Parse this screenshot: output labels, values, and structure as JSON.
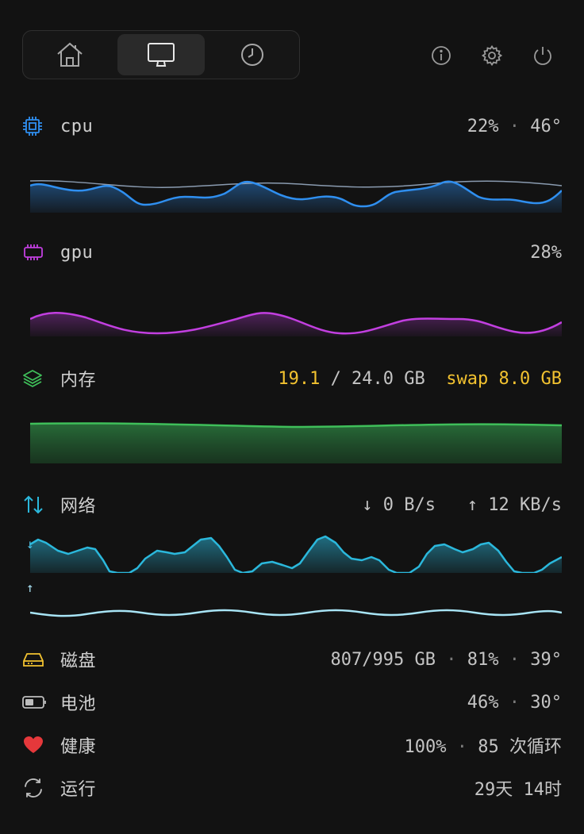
{
  "tabs": [
    {
      "name": "home",
      "icon": "home-icon",
      "active": false
    },
    {
      "name": "monitor",
      "icon": "monitor-icon",
      "active": true
    },
    {
      "name": "history",
      "icon": "clock-icon",
      "active": false
    }
  ],
  "top_actions": [
    {
      "icon": "info-icon"
    },
    {
      "icon": "gear-icon"
    },
    {
      "icon": "power-icon"
    }
  ],
  "cpu": {
    "label": "cpu",
    "usage": "22%",
    "sep": "·",
    "temp": "46°",
    "color": "#2f8ff0"
  },
  "gpu": {
    "label": "gpu",
    "usage": "28%",
    "color": "#c23fe0"
  },
  "memory": {
    "label": "内存",
    "used": "19.1",
    "total": "/ 24.0 GB",
    "swap_label": "swap",
    "swap": "8.0 GB",
    "color": "#3fbf5a"
  },
  "network": {
    "label": "网络",
    "down_arrow": "↓",
    "down": "0 B/s",
    "up_arrow": "↑",
    "up": "12 KB/s",
    "color": "#2bb8dc"
  },
  "disk": {
    "label": "磁盘",
    "used": "807/995 GB",
    "percent": "81%",
    "temp": "39°",
    "color": "#f2c230"
  },
  "battery": {
    "label": "电池",
    "percent": "46%",
    "temp": "30°"
  },
  "health": {
    "label": "健康",
    "percent": "100%",
    "cycles": "85 次循环",
    "color": "#e5383b"
  },
  "uptime": {
    "label": "运行",
    "value": "29天 14时"
  }
}
